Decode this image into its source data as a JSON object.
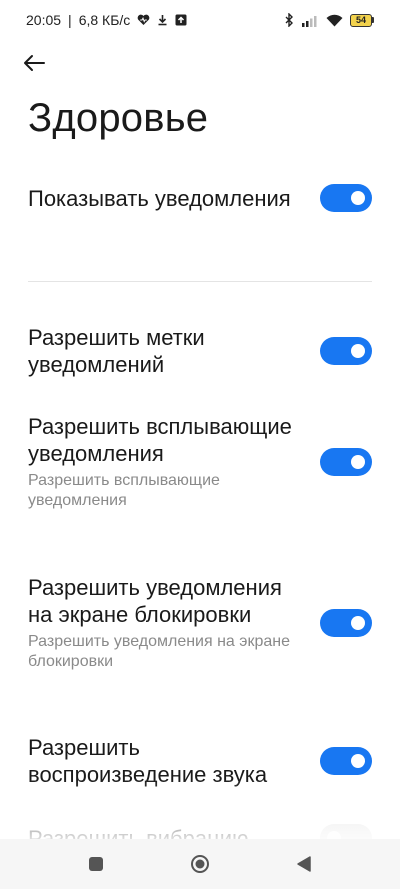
{
  "status_bar": {
    "time": "20:05",
    "separator": "|",
    "net_speed": "6,8 КБ/с",
    "battery": "54",
    "icons_left": [
      "heart-icon",
      "download-icon",
      "upload-icon"
    ],
    "icons_right": [
      "bluetooth-icon",
      "signal-icon",
      "wifi-icon",
      "battery-icon"
    ]
  },
  "header": {
    "title": "Здоровье"
  },
  "settings": [
    {
      "label": "Показывать уведомления",
      "sub": "",
      "enabled": true
    },
    {
      "label": "Разрешить метки уведомлений",
      "sub": "",
      "enabled": true
    },
    {
      "label": "Разрешить всплывающие уведомления",
      "sub": "Разрешить всплывающие уведомления",
      "enabled": true
    },
    {
      "label": "Разрешить уведомления на экране блокировки",
      "sub": "Разрешить уведомления на экране блокировки",
      "enabled": true
    },
    {
      "label": "Разрешить воспроизведение звука",
      "sub": "",
      "enabled": true
    },
    {
      "label": "Разрешить вибрацию",
      "sub": "",
      "enabled": false
    }
  ],
  "nav_bar": {
    "icons": [
      "recents-square-icon",
      "home-circle-icon",
      "back-triangle-icon"
    ]
  },
  "colors": {
    "accent": "#1877f2",
    "toggle_off": "#e6e6e6",
    "subtext": "#8a8a8a"
  }
}
